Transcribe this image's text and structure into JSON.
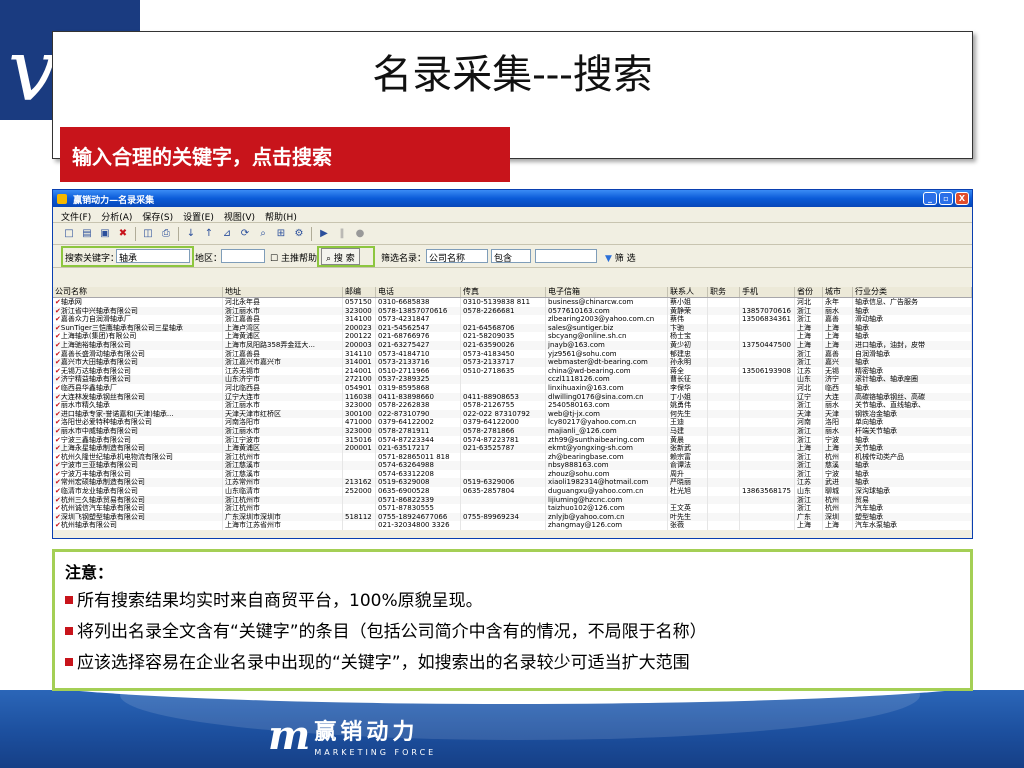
{
  "slide": {
    "title": "名录采集---搜索",
    "banner": "输入合理的关键字，点击搜索"
  },
  "window": {
    "title": "赢销动力—名录采集",
    "controls": [
      "_",
      "▫",
      "X"
    ]
  },
  "menu": [
    "文件(F)",
    "分析(A)",
    "保存(S)",
    "设置(E)",
    "视图(V)",
    "帮助(H)"
  ],
  "search": {
    "keyword_label": "搜索关键字：",
    "keyword_value": "轴承",
    "region_label": "地区：",
    "main_only_label": "主推帮助",
    "search_button": "搜 索",
    "filter_label": "筛选名录：",
    "filter_field": "公司名称",
    "filter_op": "包含",
    "filter_button": "筛 选"
  },
  "table": {
    "columns": [
      "公司名称",
      "地址",
      "邮编",
      "电话",
      "传真",
      "电子信箱",
      "联系人",
      "职务",
      "手机",
      "省份",
      "城市",
      "行业分类"
    ],
    "rows": [
      [
        "轴承网",
        "河北永年县",
        "057150",
        "0310-6685838",
        "0310-5139838 811",
        "business@chinarcw.com",
        "蔡小姐",
        "",
        "",
        "河北",
        "永年",
        "轴承信息、广告服务"
      ],
      [
        "浙江省中兴轴承有限公司",
        "浙江丽水市",
        "323000",
        "0578-13857070616",
        "0578-2266681",
        "0577610163.com",
        "黄静荣",
        "",
        "13857070616",
        "浙江",
        "丽水",
        "轴承"
      ],
      [
        "嘉善众力自润滑轴承厂",
        "浙江嘉善县",
        "314100",
        "0573-4231847",
        "",
        "zlbearing2003@yahoo.com.cn",
        "蔡伟",
        "",
        "13506834361",
        "浙江",
        "嘉善",
        "滑动轴承"
      ],
      [
        "SunTiger三恺鹰轴承有限公司三星轴承",
        "上海卢湾区",
        "200023",
        "021-54562547",
        "021-64568706",
        "sales@suntiger.biz",
        "卞驰",
        "",
        "",
        "上海",
        "上海",
        "轴承"
      ],
      [
        "上海轴承(集团)有限公司",
        "上海黄浦区",
        "200122",
        "021-68766976",
        "021-58209035",
        "sbcyang@online.sh.cn",
        "杨士宝",
        "",
        "",
        "上海",
        "上海",
        "轴承"
      ],
      [
        "上海驰裕轴承有限公司",
        "上海市凤阳路358弄金廷大...",
        "200003",
        "021-63275427",
        "021-63590026",
        "jnayb@163.com",
        "黄少初",
        "",
        "13750447500",
        "上海",
        "上海",
        "进口轴承，油封，皮带"
      ],
      [
        "嘉善长盛滑动轴承有限公司",
        "浙江嘉善县",
        "314110",
        "0573-4184710",
        "0573-4183450",
        "yjz9561@sohu.com",
        "郁建忠",
        "",
        "",
        "浙江",
        "嘉善",
        "自润滑轴承"
      ],
      [
        "嘉兴市大田轴承有限公司",
        "浙江嘉兴市嘉兴市",
        "314001",
        "0573-2133716",
        "0573-2133717",
        "webmaster@dt-bearing.com",
        "孙永明",
        "",
        "",
        "浙江",
        "嘉兴",
        "轴承"
      ],
      [
        "无锡万达轴承有限公司",
        "江苏无锡市",
        "214001",
        "0510-2711966",
        "0510-2718635",
        "china@wd-bearing.com",
        "蒋全",
        "",
        "13506193908",
        "江苏",
        "无锡",
        "精密轴承"
      ],
      [
        "济宁精益轴承有限公司",
        "山东济宁市",
        "272100",
        "0537-2389325",
        "",
        "cczl1118126.com",
        "曹长征",
        "",
        "",
        "山东",
        "济宁",
        "滚针轴承、轴承座圈"
      ],
      [
        "临西县华鑫轴承厂",
        "河北临西县",
        "054901",
        "0319-8595868",
        "",
        "linxihuaxin@163.com",
        "李保华",
        "",
        "",
        "河北",
        "临西",
        "轴承"
      ],
      [
        "大连林发轴承钢丝有限公司",
        "辽宁大连市",
        "116038",
        "0411-83898660",
        "0411-88908653",
        "dlwilling0176@sina.com.cn",
        "丁小姐",
        "",
        "",
        "辽宁",
        "大连",
        "高碳铬轴承钢丝、高碳"
      ],
      [
        "丽水市精久轴承",
        "浙江丽水市",
        "323000",
        "0578-2262838",
        "0578-2126755",
        "2540580163.com",
        "姚勇伟",
        "",
        "",
        "浙江",
        "丽水",
        "关节轴承、直线轴承、"
      ],
      [
        "进口轴承专家-誉诺嘉和(天津)轴承...",
        "天津天津市红桥区",
        "300100",
        "022-87310790",
        "022-022 87310792",
        "web@tj-jx.com",
        "何先生",
        "",
        "",
        "天津",
        "天津",
        "钢铁冶金轴承"
      ],
      [
        "洛阳世必爱特种轴承有限公司",
        "河南洛阳市",
        "471000",
        "0379-64122002",
        "0379-64122000",
        "lcy80217@yahoo.com.cn",
        "王迪",
        "",
        "",
        "河南",
        "洛阳",
        "单向轴承"
      ],
      [
        "丽水市中威轴承有限公司",
        "浙江丽水市",
        "323000",
        "0578-2781911",
        "0578-2781866",
        "majianli_@126.com",
        "马建",
        "",
        "",
        "浙江",
        "丽水",
        "杆端关节轴承"
      ],
      [
        "宁波三鑫轴承有限公司",
        "浙江宁波市",
        "315016",
        "0574-87223344",
        "0574-87223781",
        "zth99@sunthaibearing.com",
        "黄晨",
        "",
        "",
        "浙江",
        "宁波",
        "轴承"
      ],
      [
        "上海永星轴承制造有限公司",
        "上海黄浦区",
        "200001",
        "021-63517217",
        "021-63525787",
        "ekmt@yongxing-sh.com",
        "张新武",
        "",
        "",
        "上海",
        "上海",
        "关节轴承"
      ],
      [
        "杭州久隆世纪轴承机电物流有限公司",
        "浙江杭州市",
        "",
        "0571-82865011 818",
        "",
        "zh@bearingbase.com",
        "赖宗富",
        "",
        "",
        "浙江",
        "杭州",
        "机械传动类产品"
      ],
      [
        "宁波市三亚轴承有限公司",
        "浙江慈溪市",
        "",
        "0574-63264988",
        "",
        "nbsy888163.com",
        "俞谭法",
        "",
        "",
        "浙江",
        "慈溪",
        "轴承"
      ],
      [
        "宁波万丰轴承有限公司",
        "浙江慈溪市",
        "",
        "0574-63312208",
        "",
        "zhouz@sohu.com",
        "周升",
        "",
        "",
        "浙江",
        "宁波",
        "轴承"
      ],
      [
        "常州宏硕轴承制造有限公司",
        "江苏常州市",
        "213162",
        "0519-6329008",
        "0519-6329006",
        "xiaoli1982314@hotmail.com",
        "严晓丽",
        "",
        "",
        "江苏",
        "武进",
        "轴承"
      ],
      [
        "临清市龙业轴承有限公司",
        "山东临清市",
        "252000",
        "0635-6900528",
        "0635-2857804",
        "duguangxu@yahoo.com.cn",
        "杜光旭",
        "",
        "13863568175",
        "山东",
        "聊城",
        "深沟球轴承"
      ],
      [
        "杭州三久轴承贸易有限公司",
        "浙江杭州市",
        "",
        "0571-86822339",
        "",
        "lijiuming@hzcnc.com",
        "",
        "",
        "",
        "浙江",
        "杭州",
        "贸易"
      ],
      [
        "杭州诚信汽车轴承有限公司",
        "浙江杭州市",
        "",
        "0571-87830555",
        "",
        "taizhuo102@126.com",
        "王文英",
        "",
        "",
        "浙江",
        "杭州",
        "汽车轴承"
      ],
      [
        "深圳飞钢塑型轴承有限公司",
        "广东深圳市深圳市",
        "518112",
        "0755-18924677066",
        "0755-89969234",
        "znlyjb@yahoo.com.cn",
        "叶先生",
        "",
        "",
        "广东",
        "深圳",
        "塑型轴承"
      ],
      [
        "杭州轴承有限公司",
        "上海市江苏省州市",
        "",
        "021-32034800 3326",
        "",
        "zhangmay@126.com",
        "张薇",
        "",
        "",
        "上海",
        "上海",
        "汽车水泵轴承"
      ]
    ]
  },
  "notice": {
    "title": "注意：",
    "items": [
      "所有搜索结果均实时来自商贸平台，100%原貌呈现。",
      "将列出名录全文含有“关键字”的条目（包括公司简介中含有的情况，不局限于名称）",
      "应该选择容易在企业名录中出现的“关键字”，如搜索出的名录较少可适当扩大范围"
    ]
  },
  "footer": {
    "brand_cn": "赢销动力",
    "brand_en": "MARKETING FORCE"
  },
  "colors": {
    "accent_red": "#c8141b",
    "highlight_green": "#8dc63f",
    "brand_blue": "#1c4f9e"
  }
}
